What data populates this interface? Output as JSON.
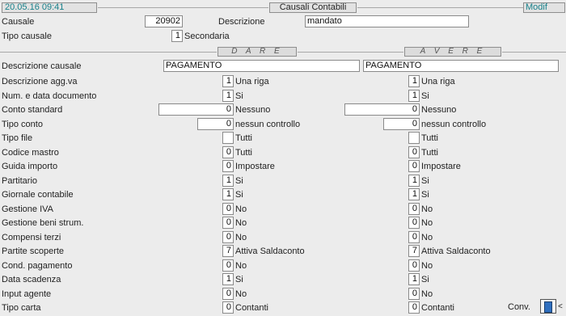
{
  "header": {
    "datetime": "20.05.16 09:41",
    "title": "Causali Contabili",
    "mode": "Modif"
  },
  "top": {
    "causale_label": "Causale",
    "causale_value": "20902",
    "descrizione_label": "Descrizione",
    "descrizione_value": "mandato",
    "tipo_label": "Tipo causale",
    "tipo_value": "1",
    "tipo_desc": "Secondaria"
  },
  "sections": {
    "dare": "D A R E",
    "avere": "A V E R E"
  },
  "desc_causale": {
    "label": "Descrizione causale",
    "dare": "PAGAMENTO",
    "avere": "PAGAMENTO"
  },
  "rows": [
    {
      "label": "Descrizione agg.va",
      "dare": {
        "value": "1",
        "text": "Una riga"
      },
      "avere": {
        "value": "1",
        "text": "Una riga"
      }
    },
    {
      "label": "Num. e data documento",
      "dare": {
        "value": "1",
        "text": "Si"
      },
      "avere": {
        "value": "1",
        "text": "Si"
      }
    },
    {
      "label": "Conto standard",
      "dare": {
        "value": "0",
        "text": "Nessuno"
      },
      "avere": {
        "value": "0",
        "text": "Nessuno"
      }
    },
    {
      "label": "Tipo conto",
      "dare": {
        "value": "0",
        "text": "nessun controllo"
      },
      "avere": {
        "value": "0",
        "text": "nessun controllo"
      }
    },
    {
      "label": "Tipo file",
      "dare": {
        "value": "",
        "text": "Tutti"
      },
      "avere": {
        "value": "",
        "text": "Tutti"
      }
    },
    {
      "label": "Codice mastro",
      "dare": {
        "value": "0",
        "text": "Tutti"
      },
      "avere": {
        "value": "0",
        "text": "Tutti"
      }
    },
    {
      "label": "Guida importo",
      "dare": {
        "value": "0",
        "text": "Impostare"
      },
      "avere": {
        "value": "0",
        "text": "Impostare"
      }
    },
    {
      "label": "Partitario",
      "dare": {
        "value": "1",
        "text": "Si"
      },
      "avere": {
        "value": "1",
        "text": "Si"
      }
    },
    {
      "label": "Giornale contabile",
      "dare": {
        "value": "1",
        "text": "Si"
      },
      "avere": {
        "value": "1",
        "text": "Si"
      }
    },
    {
      "label": "Gestione IVA",
      "dare": {
        "value": "0",
        "text": "No"
      },
      "avere": {
        "value": "0",
        "text": "No"
      }
    },
    {
      "label": "Gestione beni strum.",
      "dare": {
        "value": "0",
        "text": "No"
      },
      "avere": {
        "value": "0",
        "text": "No"
      }
    },
    {
      "label": "Compensi terzi",
      "dare": {
        "value": "0",
        "text": "No"
      },
      "avere": {
        "value": "0",
        "text": "No"
      }
    },
    {
      "label": "Partite scoperte",
      "dare": {
        "value": "7",
        "text": "Attiva Saldaconto"
      },
      "avere": {
        "value": "7",
        "text": "Attiva Saldaconto"
      }
    },
    {
      "label": "Cond. pagamento",
      "dare": {
        "value": "0",
        "text": "No"
      },
      "avere": {
        "value": "0",
        "text": "No"
      }
    },
    {
      "label": "Data scadenza",
      "dare": {
        "value": "1",
        "text": "Si"
      },
      "avere": {
        "value": "1",
        "text": "Si"
      }
    },
    {
      "label": "Input agente",
      "dare": {
        "value": "0",
        "text": "No"
      },
      "avere": {
        "value": "0",
        "text": "No"
      }
    },
    {
      "label": "Tipo carta",
      "dare": {
        "value": "0",
        "text": "Contanti"
      },
      "avere": {
        "value": "0",
        "text": "Contanti"
      }
    }
  ],
  "footer": {
    "conv_label": "Conv."
  }
}
